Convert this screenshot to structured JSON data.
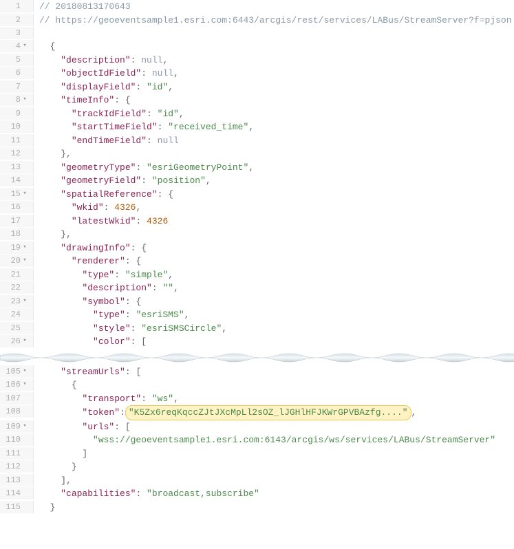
{
  "lines_top": [
    {
      "num": "1",
      "fold": "",
      "indent": 0,
      "tokens": [
        {
          "c": "cm",
          "t": "// 20180813170643"
        }
      ]
    },
    {
      "num": "2",
      "fold": "",
      "indent": 0,
      "tokens": [
        {
          "c": "cm",
          "t": "// https://geoeventsample1.esri.com:6443/arcgis/rest/services/LABus/StreamServer?f=pjson"
        }
      ]
    },
    {
      "num": "3",
      "fold": "",
      "indent": 0,
      "tokens": []
    },
    {
      "num": "4",
      "fold": "▾",
      "indent": 1,
      "tokens": [
        {
          "c": "pn",
          "t": "{"
        }
      ]
    },
    {
      "num": "5",
      "fold": "",
      "indent": 2,
      "tokens": [
        {
          "c": "ky",
          "t": "\"description\""
        },
        {
          "c": "pn",
          "t": ": "
        },
        {
          "c": "nl",
          "t": "null"
        },
        {
          "c": "pn",
          "t": ","
        }
      ]
    },
    {
      "num": "6",
      "fold": "",
      "indent": 2,
      "tokens": [
        {
          "c": "ky",
          "t": "\"objectIdField\""
        },
        {
          "c": "pn",
          "t": ": "
        },
        {
          "c": "nl",
          "t": "null"
        },
        {
          "c": "pn",
          "t": ","
        }
      ]
    },
    {
      "num": "7",
      "fold": "",
      "indent": 2,
      "tokens": [
        {
          "c": "ky",
          "t": "\"displayField\""
        },
        {
          "c": "pn",
          "t": ": "
        },
        {
          "c": "st",
          "t": "\"id\""
        },
        {
          "c": "pn",
          "t": ","
        }
      ]
    },
    {
      "num": "8",
      "fold": "▾",
      "indent": 2,
      "tokens": [
        {
          "c": "ky",
          "t": "\"timeInfo\""
        },
        {
          "c": "pn",
          "t": ": {"
        }
      ]
    },
    {
      "num": "9",
      "fold": "",
      "indent": 3,
      "tokens": [
        {
          "c": "ky",
          "t": "\"trackIdField\""
        },
        {
          "c": "pn",
          "t": ": "
        },
        {
          "c": "st",
          "t": "\"id\""
        },
        {
          "c": "pn",
          "t": ","
        }
      ]
    },
    {
      "num": "10",
      "fold": "",
      "indent": 3,
      "tokens": [
        {
          "c": "ky",
          "t": "\"startTimeField\""
        },
        {
          "c": "pn",
          "t": ": "
        },
        {
          "c": "st",
          "t": "\"received_time\""
        },
        {
          "c": "pn",
          "t": ","
        }
      ]
    },
    {
      "num": "11",
      "fold": "",
      "indent": 3,
      "tokens": [
        {
          "c": "ky",
          "t": "\"endTimeField\""
        },
        {
          "c": "pn",
          "t": ": "
        },
        {
          "c": "nl",
          "t": "null"
        }
      ]
    },
    {
      "num": "12",
      "fold": "",
      "indent": 2,
      "tokens": [
        {
          "c": "pn",
          "t": "},"
        }
      ]
    },
    {
      "num": "13",
      "fold": "",
      "indent": 2,
      "tokens": [
        {
          "c": "ky",
          "t": "\"geometryType\""
        },
        {
          "c": "pn",
          "t": ": "
        },
        {
          "c": "st",
          "t": "\"esriGeometryPoint\""
        },
        {
          "c": "pn",
          "t": ","
        }
      ]
    },
    {
      "num": "14",
      "fold": "",
      "indent": 2,
      "tokens": [
        {
          "c": "ky",
          "t": "\"geometryField\""
        },
        {
          "c": "pn",
          "t": ": "
        },
        {
          "c": "st",
          "t": "\"position\""
        },
        {
          "c": "pn",
          "t": ","
        }
      ]
    },
    {
      "num": "15",
      "fold": "▾",
      "indent": 2,
      "tokens": [
        {
          "c": "ky",
          "t": "\"spatialReference\""
        },
        {
          "c": "pn",
          "t": ": {"
        }
      ]
    },
    {
      "num": "16",
      "fold": "",
      "indent": 3,
      "tokens": [
        {
          "c": "ky",
          "t": "\"wkid\""
        },
        {
          "c": "pn",
          "t": ": "
        },
        {
          "c": "nm",
          "t": "4326"
        },
        {
          "c": "pn",
          "t": ","
        }
      ]
    },
    {
      "num": "17",
      "fold": "",
      "indent": 3,
      "tokens": [
        {
          "c": "ky",
          "t": "\"latestWkid\""
        },
        {
          "c": "pn",
          "t": ": "
        },
        {
          "c": "nm",
          "t": "4326"
        }
      ]
    },
    {
      "num": "18",
      "fold": "",
      "indent": 2,
      "tokens": [
        {
          "c": "pn",
          "t": "},"
        }
      ]
    },
    {
      "num": "19",
      "fold": "▾",
      "indent": 2,
      "tokens": [
        {
          "c": "ky",
          "t": "\"drawingInfo\""
        },
        {
          "c": "pn",
          "t": ": {"
        }
      ]
    },
    {
      "num": "20",
      "fold": "▾",
      "indent": 3,
      "tokens": [
        {
          "c": "ky",
          "t": "\"renderer\""
        },
        {
          "c": "pn",
          "t": ": {"
        }
      ]
    },
    {
      "num": "21",
      "fold": "",
      "indent": 4,
      "tokens": [
        {
          "c": "ky",
          "t": "\"type\""
        },
        {
          "c": "pn",
          "t": ": "
        },
        {
          "c": "st",
          "t": "\"simple\""
        },
        {
          "c": "pn",
          "t": ","
        }
      ]
    },
    {
      "num": "22",
      "fold": "",
      "indent": 4,
      "tokens": [
        {
          "c": "ky",
          "t": "\"description\""
        },
        {
          "c": "pn",
          "t": ": "
        },
        {
          "c": "st",
          "t": "\"\""
        },
        {
          "c": "pn",
          "t": ","
        }
      ]
    },
    {
      "num": "23",
      "fold": "▾",
      "indent": 4,
      "tokens": [
        {
          "c": "ky",
          "t": "\"symbol\""
        },
        {
          "c": "pn",
          "t": ": {"
        }
      ]
    },
    {
      "num": "24",
      "fold": "",
      "indent": 5,
      "tokens": [
        {
          "c": "ky",
          "t": "\"type\""
        },
        {
          "c": "pn",
          "t": ": "
        },
        {
          "c": "st",
          "t": "\"esriSMS\""
        },
        {
          "c": "pn",
          "t": ","
        }
      ]
    },
    {
      "num": "25",
      "fold": "",
      "indent": 5,
      "tokens": [
        {
          "c": "ky",
          "t": "\"style\""
        },
        {
          "c": "pn",
          "t": ": "
        },
        {
          "c": "st",
          "t": "\"esriSMSCircle\""
        },
        {
          "c": "pn",
          "t": ","
        }
      ]
    },
    {
      "num": "26",
      "fold": "▾",
      "indent": 5,
      "tokens": [
        {
          "c": "ky",
          "t": "\"color\""
        },
        {
          "c": "pn",
          "t": ": ["
        }
      ]
    }
  ],
  "lines_bottom": [
    {
      "num": "105",
      "fold": "▾",
      "indent": 2,
      "tokens": [
        {
          "c": "ky",
          "t": "\"streamUrls\""
        },
        {
          "c": "pn",
          "t": ": ["
        }
      ]
    },
    {
      "num": "106",
      "fold": "▾",
      "indent": 3,
      "tokens": [
        {
          "c": "pn",
          "t": "{"
        }
      ]
    },
    {
      "num": "107",
      "fold": "",
      "indent": 4,
      "tokens": [
        {
          "c": "ky",
          "t": "\"transport\""
        },
        {
          "c": "pn",
          "t": ": "
        },
        {
          "c": "st",
          "t": "\"ws\""
        },
        {
          "c": "pn",
          "t": ","
        }
      ]
    },
    {
      "num": "108",
      "fold": "",
      "indent": 4,
      "tokens": [
        {
          "c": "ky",
          "t": "\"token\""
        },
        {
          "c": "pn",
          "t": ":"
        },
        {
          "c": "hl",
          "t": "\"K5Zx6reqKqccZJtJXcMpLl2sOZ_lJGHlHFJKWrGPVBAzfg....\""
        },
        {
          "c": "pn",
          "t": ","
        }
      ]
    },
    {
      "num": "109",
      "fold": "▾",
      "indent": 4,
      "tokens": [
        {
          "c": "ky",
          "t": "\"urls\""
        },
        {
          "c": "pn",
          "t": ": ["
        }
      ]
    },
    {
      "num": "110",
      "fold": "",
      "indent": 5,
      "tokens": [
        {
          "c": "st",
          "t": "\"wss://geoeventsample1.esri.com:6143/arcgis/ws/services/LABus/StreamServer\""
        }
      ]
    },
    {
      "num": "111",
      "fold": "",
      "indent": 4,
      "tokens": [
        {
          "c": "pn",
          "t": "]"
        }
      ]
    },
    {
      "num": "112",
      "fold": "",
      "indent": 3,
      "tokens": [
        {
          "c": "pn",
          "t": "}"
        }
      ]
    },
    {
      "num": "113",
      "fold": "",
      "indent": 2,
      "tokens": [
        {
          "c": "pn",
          "t": "],"
        }
      ]
    },
    {
      "num": "114",
      "fold": "",
      "indent": 2,
      "tokens": [
        {
          "c": "ky",
          "t": "\"capabilities\""
        },
        {
          "c": "pn",
          "t": ": "
        },
        {
          "c": "st",
          "t": "\"broadcast,subscribe\""
        }
      ]
    },
    {
      "num": "115",
      "fold": "",
      "indent": 1,
      "tokens": [
        {
          "c": "pn",
          "t": "}"
        }
      ]
    }
  ]
}
